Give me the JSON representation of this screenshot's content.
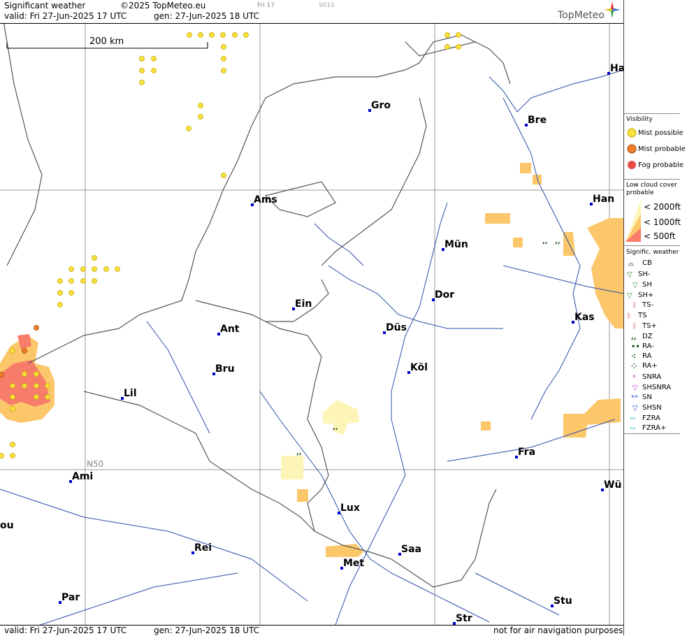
{
  "header": {
    "title": "Significant weather",
    "copyright": "©2025 TopMeteo.eu",
    "frame": "Fri 17",
    "code": "9010",
    "valid": "valid:  Fri   27-Jun-2025  17 UTC",
    "gen": "gen:  27-Jun-2025  18 UTC",
    "brand": "TopMeteo"
  },
  "footer": {
    "valid": "valid:  Fri   27-Jun-2025  17 UTC",
    "gen": "gen:  27-Jun-2025  18 UTC",
    "note": "not for air navigation purposes"
  },
  "scale": {
    "label": "200 km"
  },
  "gridlabel": "N50",
  "cities": [
    {
      "name": "Gro"
    },
    {
      "name": "Bre"
    },
    {
      "name": "Ha"
    },
    {
      "name": "Ams"
    },
    {
      "name": "Han"
    },
    {
      "name": "Mün"
    },
    {
      "name": "Ein"
    },
    {
      "name": "Dor"
    },
    {
      "name": "Kas"
    },
    {
      "name": "Ant"
    },
    {
      "name": "Düs"
    },
    {
      "name": "Bru"
    },
    {
      "name": "Köl"
    },
    {
      "name": "Lil"
    },
    {
      "name": "Fra"
    },
    {
      "name": "Ami"
    },
    {
      "name": "Wü"
    },
    {
      "name": "Lux"
    },
    {
      "name": "ou"
    },
    {
      "name": "Rei"
    },
    {
      "name": "Saa"
    },
    {
      "name": "Met"
    },
    {
      "name": "Par"
    },
    {
      "name": "Stu"
    },
    {
      "name": "Str"
    }
  ],
  "legend": {
    "visibility_title": "Visibility",
    "mist_possible": "Mist possible",
    "mist_probable": "Mist probable",
    "fog_probable": "Fog probable",
    "lowcloud_title": "Low cloud cover",
    "lowcloud_title2": "probable",
    "lc1": "< 2000ft",
    "lc2": "< 1000ft",
    "lc3": "<   500ft",
    "sigwx_title": "Signific. weather",
    "items": [
      "CB",
      "SH-",
      "SH",
      "SH+",
      "TS-",
      "TS",
      "TS+",
      "DZ",
      "RA-",
      "RA",
      "RA+",
      "SNRA",
      "SHSNRA",
      "SN",
      "SHSN",
      "FZRA",
      "FZRA+"
    ],
    "colors": {
      "mist": "#f6e23a",
      "mist2": "#f07d2a",
      "fog": "#e84a4a",
      "lc1": "#fdf5b8",
      "lc2": "#fbc76a",
      "lc3": "#f77c6a"
    }
  }
}
